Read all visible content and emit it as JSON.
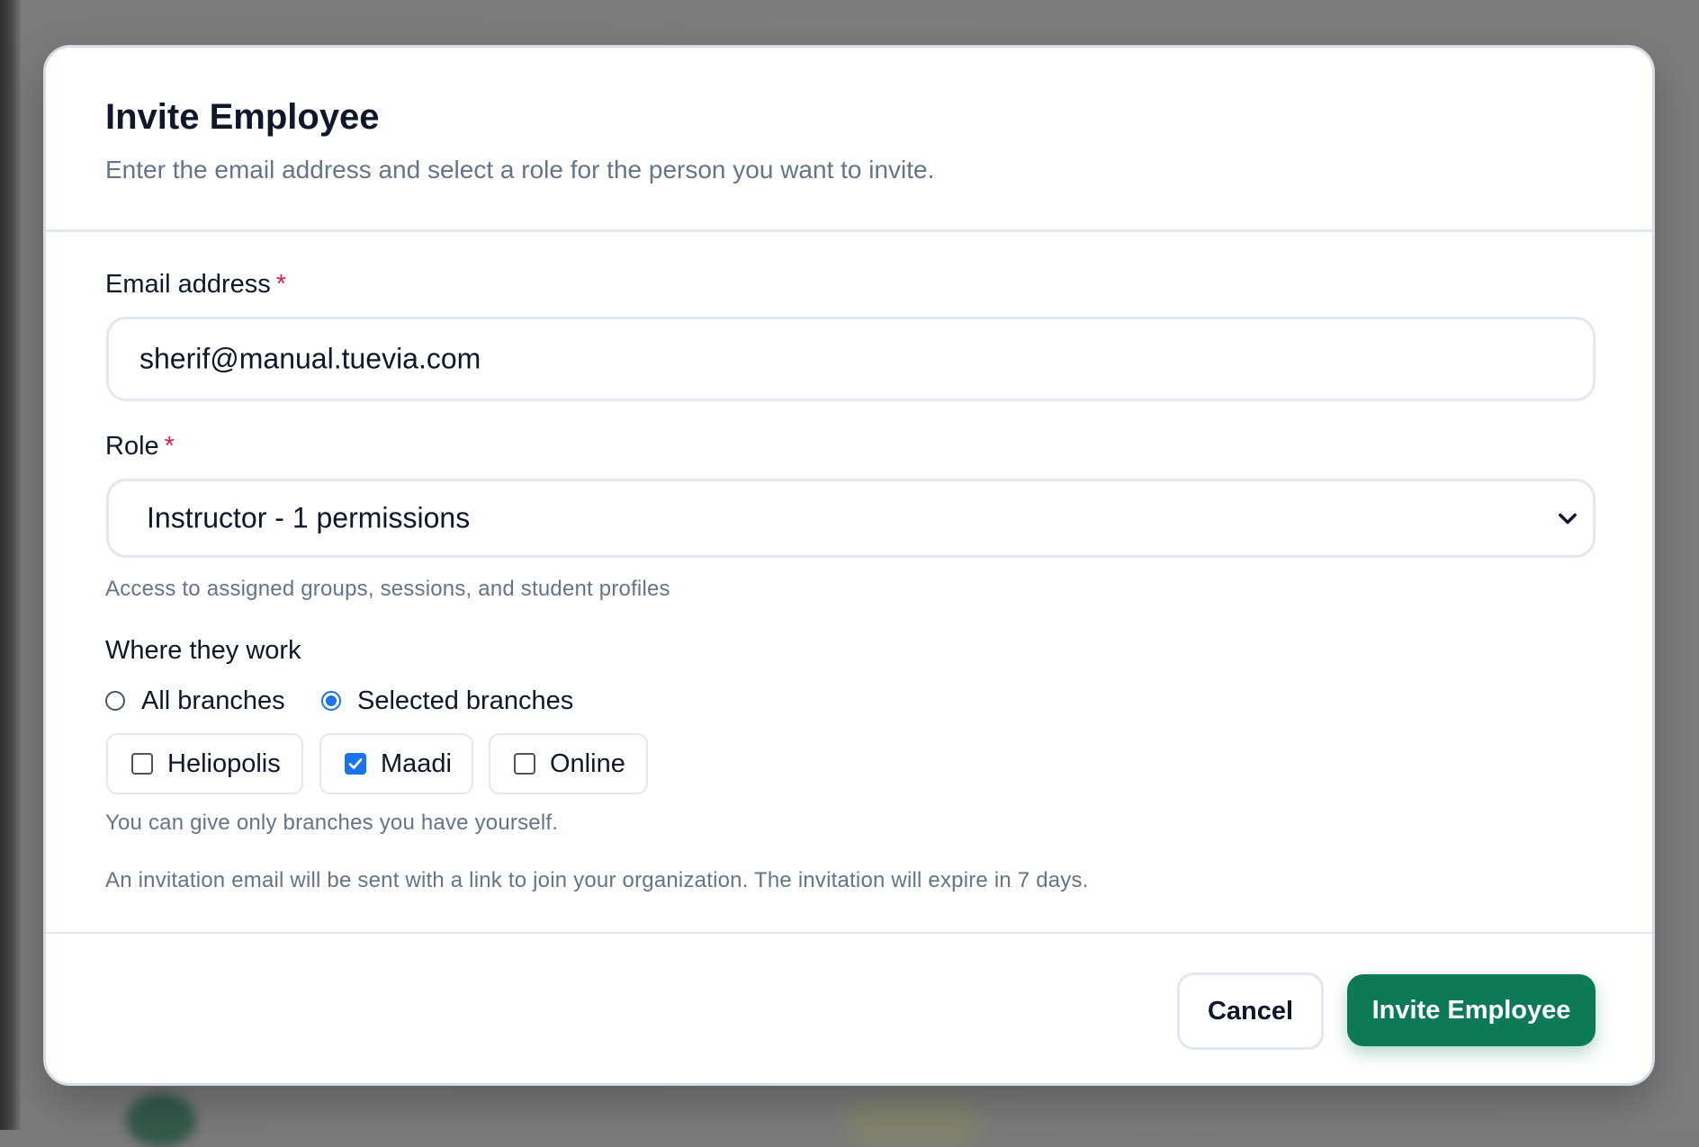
{
  "modal": {
    "title": "Invite Employee",
    "subtitle": "Enter the email address and select a role for the person you want to invite."
  },
  "email": {
    "label": "Email address",
    "required_mark": "*",
    "value": "sherif@manual.tuevia.com"
  },
  "role": {
    "label": "Role",
    "required_mark": "*",
    "selected": "Instructor - 1 permissions",
    "description": "Access to assigned groups, sessions, and student profiles"
  },
  "work_location": {
    "label": "Where they work",
    "options": [
      {
        "label": "All branches",
        "checked": false
      },
      {
        "label": "Selected branches",
        "checked": true
      }
    ],
    "branches": [
      {
        "label": "Heliopolis",
        "checked": false
      },
      {
        "label": "Maadi",
        "checked": true
      },
      {
        "label": "Online",
        "checked": false
      }
    ],
    "note": "You can give only branches you have yourself."
  },
  "invitation_note": "An invitation email will be sent with a link to join your organization. The invitation will expire in 7 days.",
  "footer": {
    "cancel_label": "Cancel",
    "submit_label": "Invite Employee"
  },
  "colors": {
    "accent": "#0c7a56",
    "check_blue": "#1a73e8",
    "required": "#e11d48"
  },
  "icons": {
    "select_toggle": "chevron-down-icon",
    "checkmark": "check-icon"
  }
}
